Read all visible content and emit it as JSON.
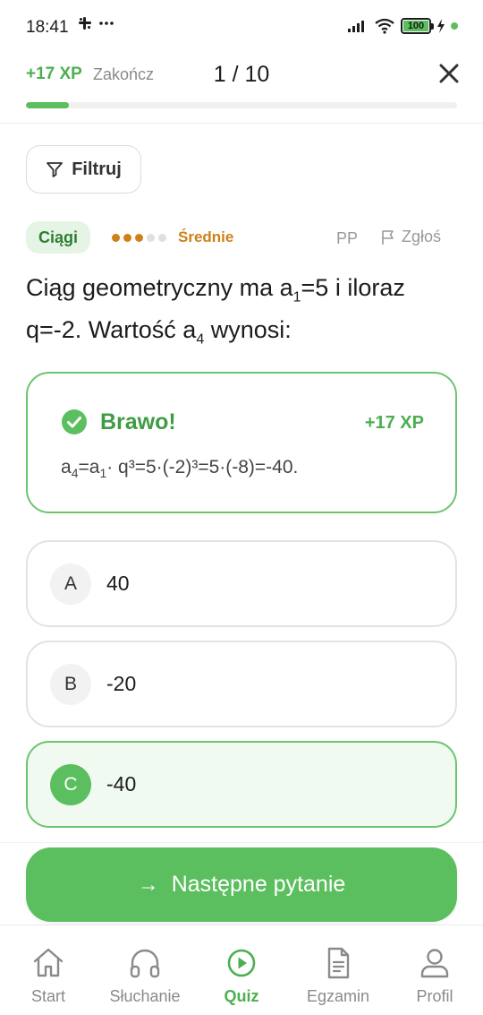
{
  "status_bar": {
    "time": "18:41",
    "battery": "100",
    "icons": [
      "slack-icon",
      "more-dots-icon",
      "signal-icon",
      "wifi-icon",
      "battery-icon",
      "charging-icon",
      "dot-icon"
    ]
  },
  "header": {
    "xp_earned": "+17 XP",
    "end_label": "Zakończ",
    "counter": "1 / 10",
    "progress_fraction": 0.1
  },
  "filter": {
    "label": "Filtruj"
  },
  "meta": {
    "category": "Ciągi",
    "difficulty_label": "Średnie",
    "difficulty_level": 3,
    "difficulty_max": 5,
    "level": "PP",
    "report_label": "Zgłoś"
  },
  "question": {
    "part1": "Ciąg geometryczny ma a",
    "sub1": "1",
    "part2": "=5 i iloraz q=-2. Wartość a",
    "sub2": "4",
    "part3": " wynosi:"
  },
  "feedback": {
    "title": "Brawo!",
    "xp": "+17 XP",
    "expl_a": "a",
    "expl_sub1": "4",
    "expl_b": "=a",
    "expl_sub2": "1",
    "expl_c": "· q³=5·(-2)³=5·(-8)=-40."
  },
  "options": [
    {
      "letter": "A",
      "text": "40"
    },
    {
      "letter": "B",
      "text": "-20"
    },
    {
      "letter": "C",
      "text": "-40"
    }
  ],
  "next_button": {
    "label": "Następne pytanie",
    "arrow": "→"
  },
  "nav": [
    {
      "label": "Start",
      "icon": "home-icon"
    },
    {
      "label": "Słuchanie",
      "icon": "headphones-icon"
    },
    {
      "label": "Quiz",
      "icon": "play-circle-icon"
    },
    {
      "label": "Egzamin",
      "icon": "document-icon"
    },
    {
      "label": "Profil",
      "icon": "user-icon"
    }
  ],
  "colors": {
    "accent": "#5cbf5f",
    "accent_dark": "#3f9c44",
    "difficulty": "#d08018",
    "category_bg": "#e6f4e6"
  }
}
